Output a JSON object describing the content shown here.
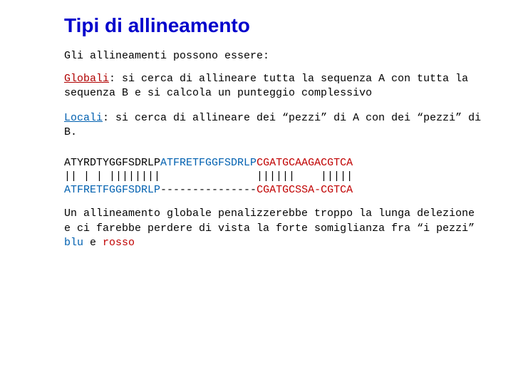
{
  "title": "Tipi di allineamento",
  "intro": "Gli allineamenti possono essere:",
  "globali": {
    "label": "Globali",
    "text": ": si cerca di allineare tutta la sequenza A con tutta la sequenza B e si calcola un punteggio complessivo"
  },
  "locali": {
    "label": "Locali",
    "text": ": si cerca di allineare dei “pezzi” di A con dei “pezzi” di  B."
  },
  "alignment": {
    "top": {
      "seg1_black": "ATYRDTYGGFSDRLP",
      "seg2_blue": "ATFRETFGGFSDRLP",
      "seg3_red": "CGATGCAAGACGTCA"
    },
    "bars": "|| | | ||||||||               ||||||    |||||",
    "bottom": {
      "seg1_blue": "ATFRETFGGFSDRLP",
      "seg2_black": "---------------",
      "seg3_red": "CGATGCSSA-CGTCA"
    }
  },
  "closing": {
    "pre": "Un allineamento globale penalizzerebbe troppo la lunga delezione e ci farebbe perdere di vista la forte somiglianza fra “i pezzi” ",
    "blue": "blu",
    "mid": " e ",
    "red": "rosso"
  }
}
